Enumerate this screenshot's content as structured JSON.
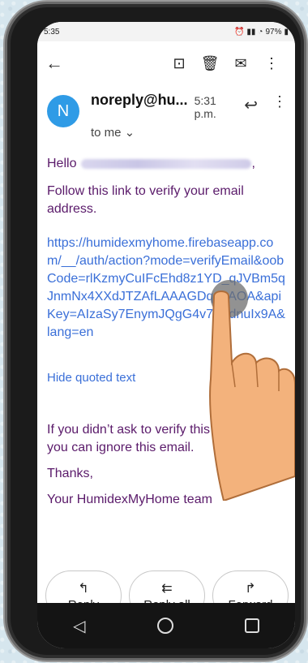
{
  "status": {
    "time": "5:35",
    "battery": "97%"
  },
  "appbar": {
    "back_icon": "arrow-left-icon",
    "archive_icon": "archive-icon",
    "delete_icon": "trash-icon",
    "mail_icon": "mail-icon",
    "more_icon": "more-vert-icon"
  },
  "email": {
    "avatar_letter": "N",
    "sender": "noreply@hu...",
    "time": "5:31 p.m.",
    "to": "to me ⌄",
    "hello": "Hello",
    "hello_comma": ",",
    "line1": "Follow this link to verify your email address.",
    "link": "https://humidexmyhome.firebaseapp.com/__/auth/action?mode=verifyEmail&oobCode=rlKzmyCuIFcEhd8z1YD_qJVBm5qJnmNx4XXdJTZAfLAAAGDqdhAOA&apiKey=AIzaSy7EnymJQgG4v7oPdnuIx9A&lang=en",
    "hide_quoted": "Hide quoted text",
    "line2": "If you didn’t ask to verify this address, you can ignore this email.",
    "thanks": "Thanks,",
    "team": "Your HumidexMyHome team"
  },
  "actions": {
    "reply": "Reply",
    "reply_all": "Reply all",
    "forward": "Forward"
  },
  "colors": {
    "avatar": "#2f9be6",
    "body_text": "#5a1a6a",
    "link": "#3a6fd8"
  }
}
